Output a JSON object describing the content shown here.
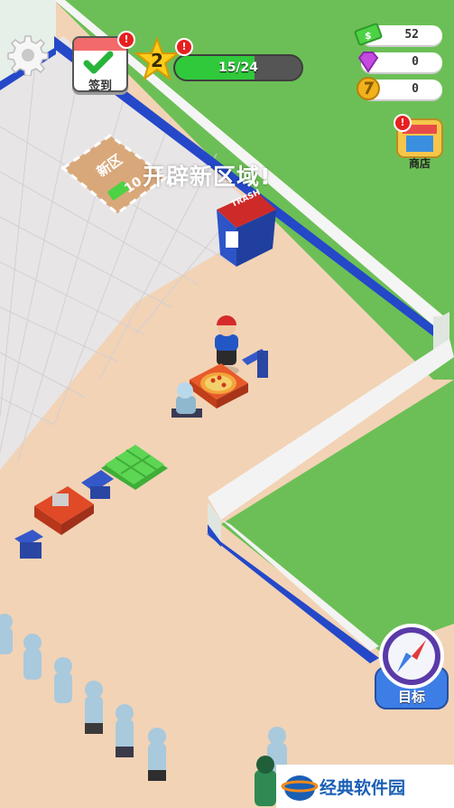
{
  "hud": {
    "checkin_label": "签到",
    "level": "2",
    "xp_text": "15/24",
    "xp_fraction": 0.625,
    "cash": "52",
    "gems": "0",
    "tokens": "0",
    "shop_label": "商店",
    "alert_mark": "!",
    "target_label": "目标"
  },
  "world": {
    "announcement": "开辟新区域!",
    "expansion_sign": "新区",
    "expansion_cost": "10",
    "trash_label": "TRASH"
  },
  "watermark": {
    "text": "经典软件园"
  },
  "colors": {
    "grass": "#6cbf56",
    "floor": "#f2d3b6",
    "tile": "#e7e4e6",
    "wall_blue": "#2448c8",
    "cash_green": "#4dd244",
    "xp_green": "#2fc93b",
    "alert_red": "#e62020"
  }
}
